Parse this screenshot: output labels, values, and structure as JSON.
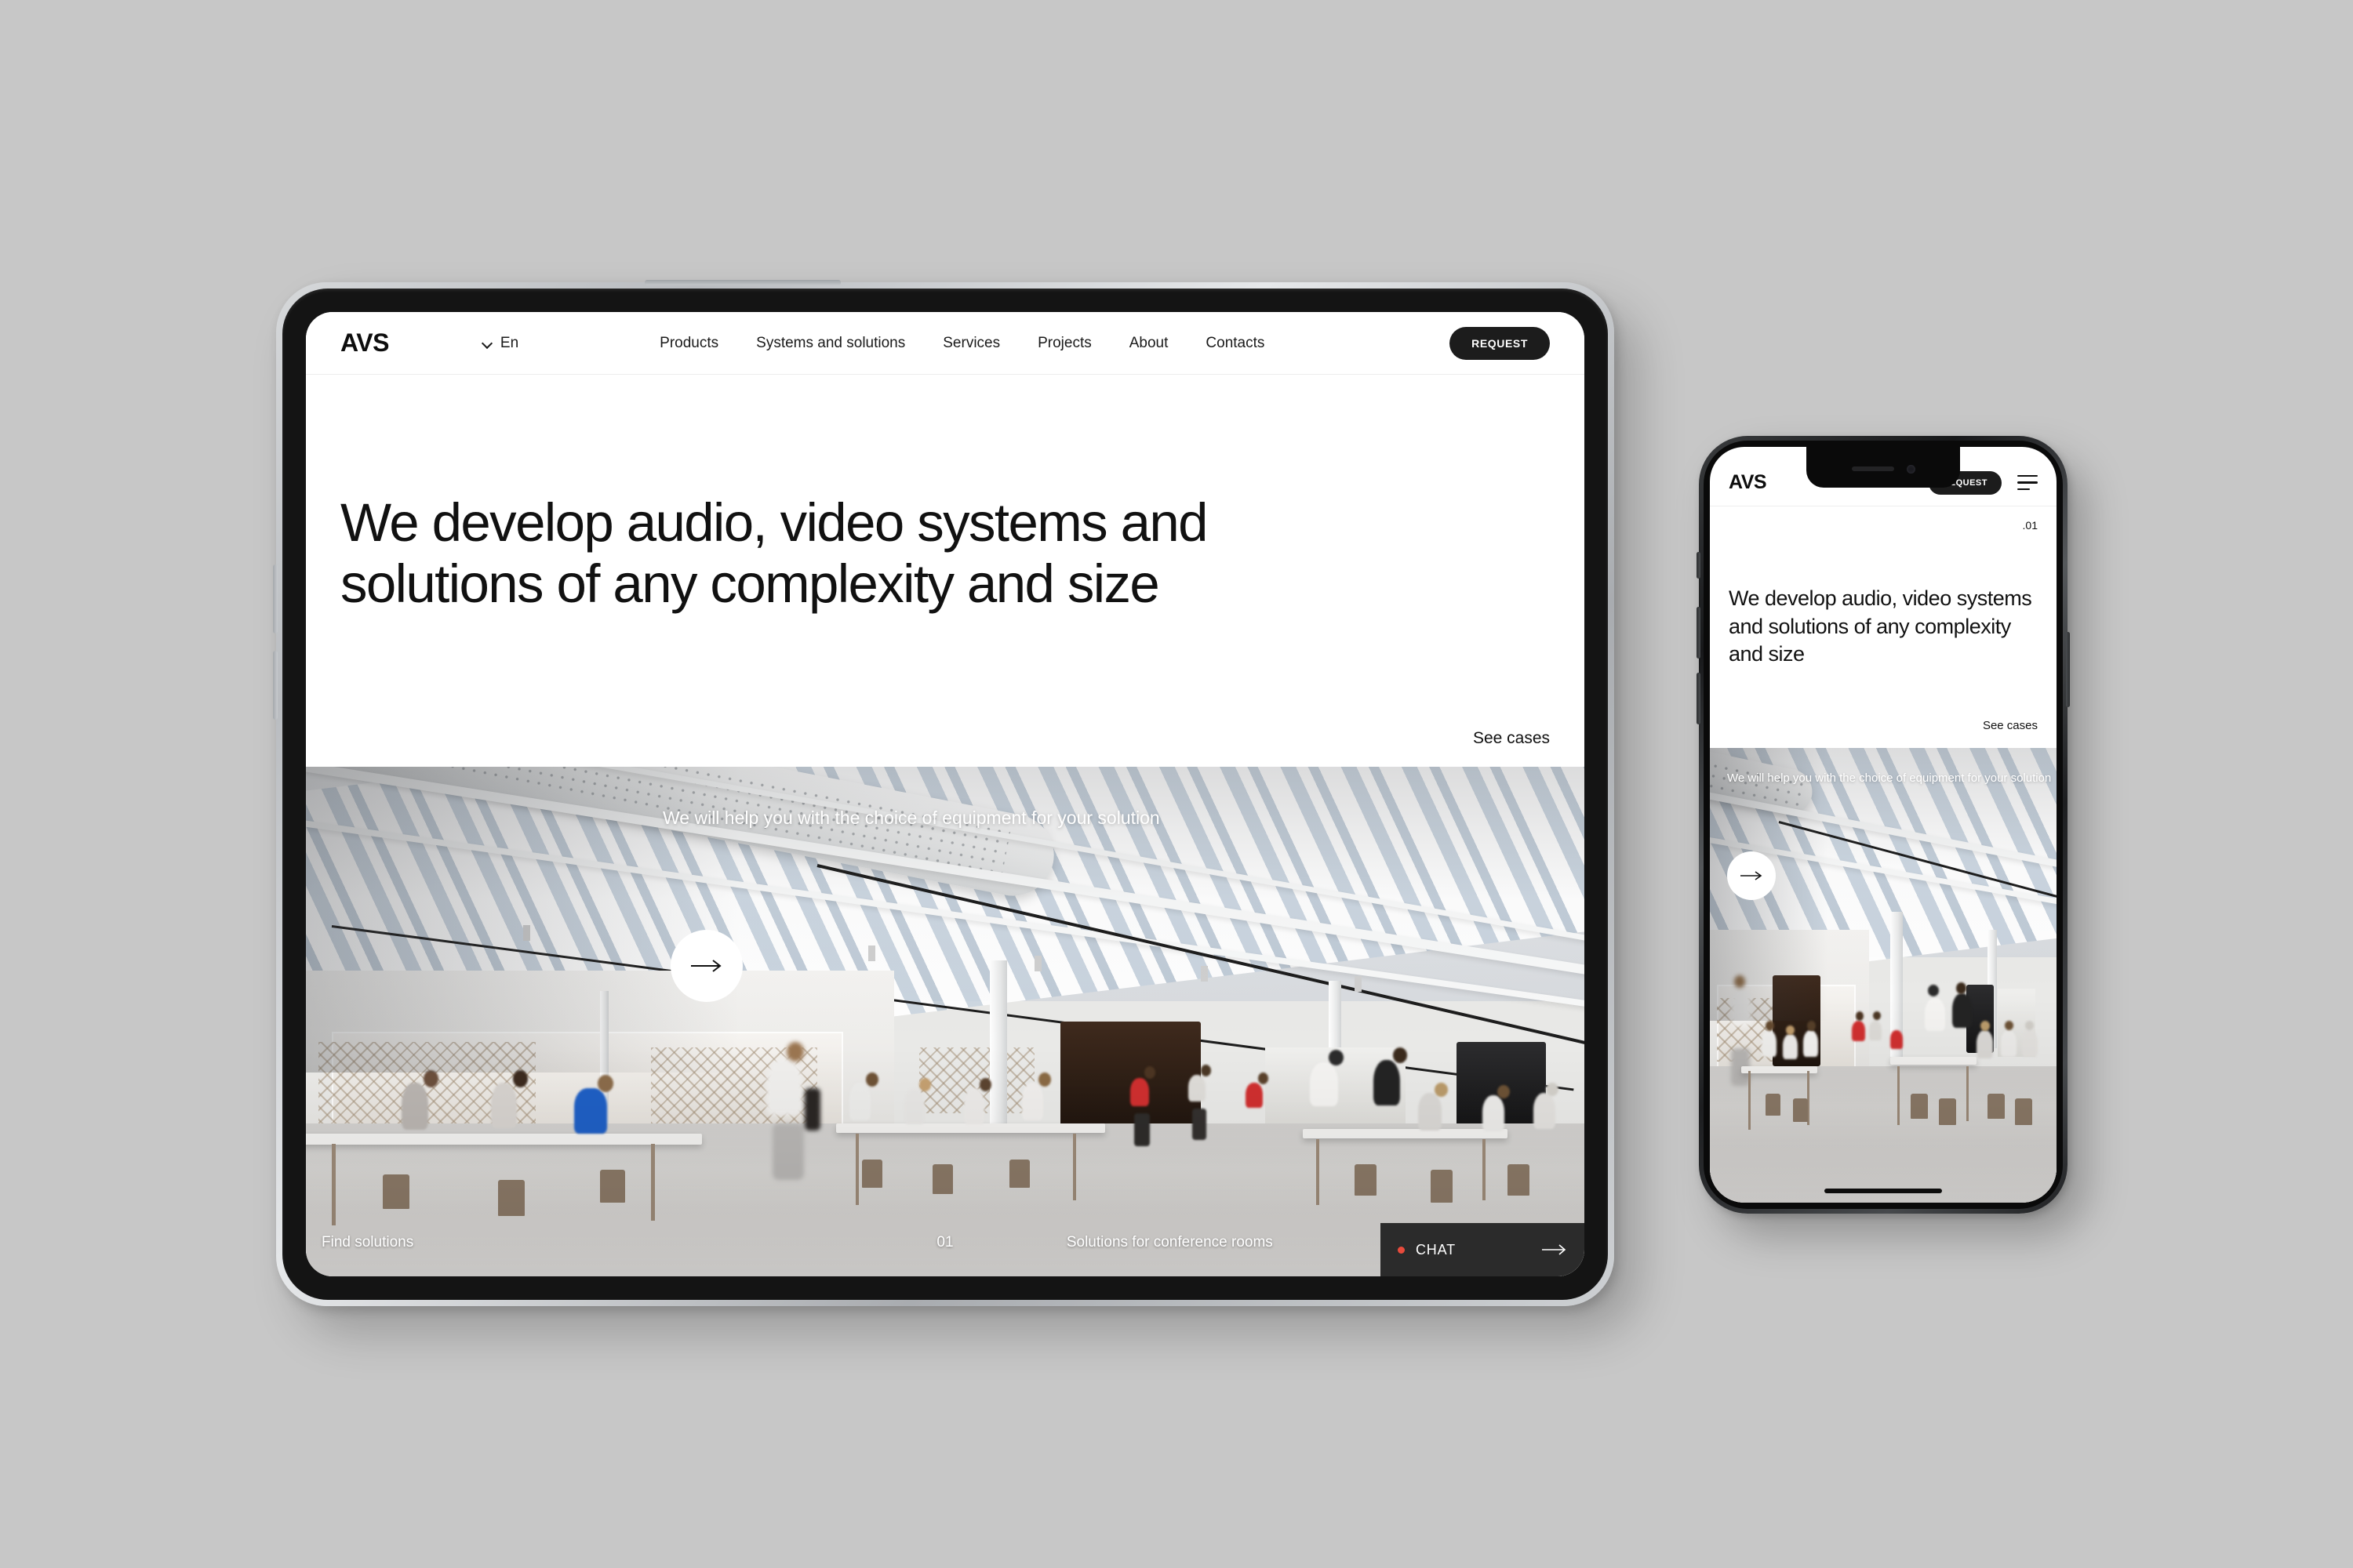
{
  "site": {
    "logo": "AVS",
    "language": "En",
    "request_label": "REQUEST"
  },
  "tablet": {
    "nav_items": [
      {
        "label": "Products"
      },
      {
        "label": "Systems and solutions"
      },
      {
        "label": "Services"
      },
      {
        "label": "Projects"
      },
      {
        "label": "About"
      },
      {
        "label": "Contacts"
      }
    ],
    "headline": "We develop audio, video systems and solutions of any complexity and size",
    "see_cases": "See cases",
    "overlay_text": "We will help you with the choice of equipment for your solution",
    "find_solutions": "Find solutions",
    "slide_number": "01",
    "slide_title": "Solutions for conference rooms",
    "chat_label": "CHAT"
  },
  "phone": {
    "counter": ".01",
    "headline": "We develop audio, video systems and solutions of any complexity and size",
    "see_cases": "See cases",
    "overlay_text": "We will help you with the choice of equipment for your solution"
  },
  "colors": {
    "background": "#c7c7c7",
    "ink": "#111111",
    "button_dark": "#1c1c1c",
    "chat_bar": "#2b2b2b",
    "chat_dot": "#e84b3c",
    "surface": "#ffffff"
  },
  "icons": {
    "chevron_down": "chevron-down-icon",
    "arrow_right": "arrow-right-icon",
    "hamburger": "hamburger-menu-icon",
    "status_dot": "status-dot-icon"
  }
}
